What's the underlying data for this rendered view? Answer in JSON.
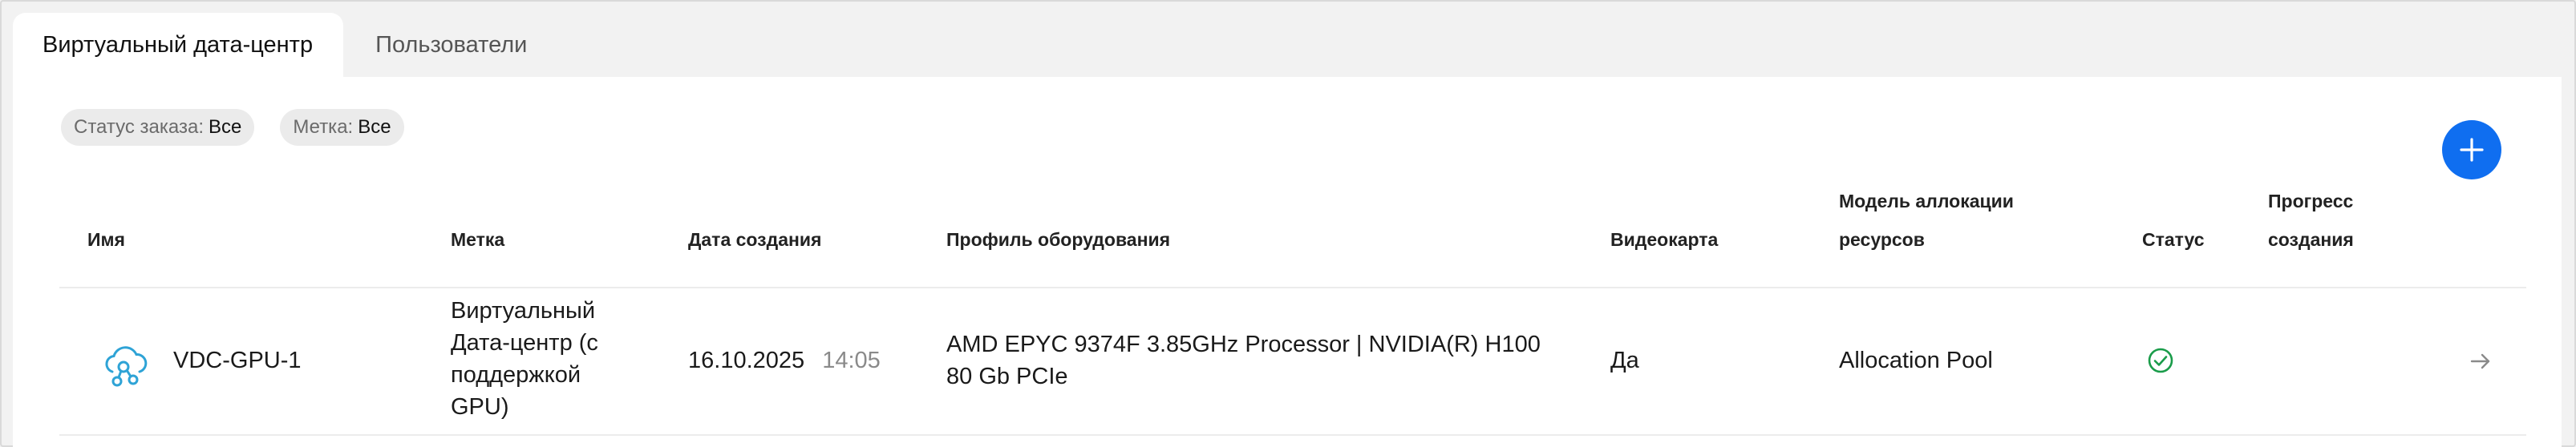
{
  "tabs": [
    {
      "label": "Виртуальный дата-центр",
      "active": true
    },
    {
      "label": "Пользователи",
      "active": false
    }
  ],
  "filters": [
    {
      "label": "Статус заказа:",
      "value": "Все"
    },
    {
      "label": "Метка:",
      "value": "Все"
    }
  ],
  "add_button": {
    "icon": "plus-icon"
  },
  "table": {
    "headers": {
      "name": "Имя",
      "label": "Метка",
      "created": "Дата создания",
      "profile": "Профиль оборудования",
      "gpu": "Видеокарта",
      "allocation_line1": "Модель аллокации",
      "allocation_line2": "ресурсов",
      "status": "Статус",
      "progress_line1": "Прогресс",
      "progress_line2": "создания"
    },
    "rows": [
      {
        "icon": "cloud-network-icon",
        "name": "VDC-GPU-1",
        "label_lines": [
          "Виртуальный",
          "Дата-центр (с",
          "поддержкой",
          "GPU)"
        ],
        "date": "16.10.2025",
        "time": "14:05",
        "profile_lines": [
          "AMD EPYC 9374F 3.85GHz Processor | NVIDIA(R) H100",
          "80 Gb PCIe"
        ],
        "gpu": "Да",
        "allocation": "Allocation Pool",
        "status_icon": "check-circle-icon",
        "status_color": "#1a9c4a",
        "action_icon": "arrow-right-icon"
      }
    ]
  },
  "colors": {
    "accent": "#0f6ef0",
    "cloud_icon": "#2ea3d6",
    "success": "#1a9c4a"
  }
}
